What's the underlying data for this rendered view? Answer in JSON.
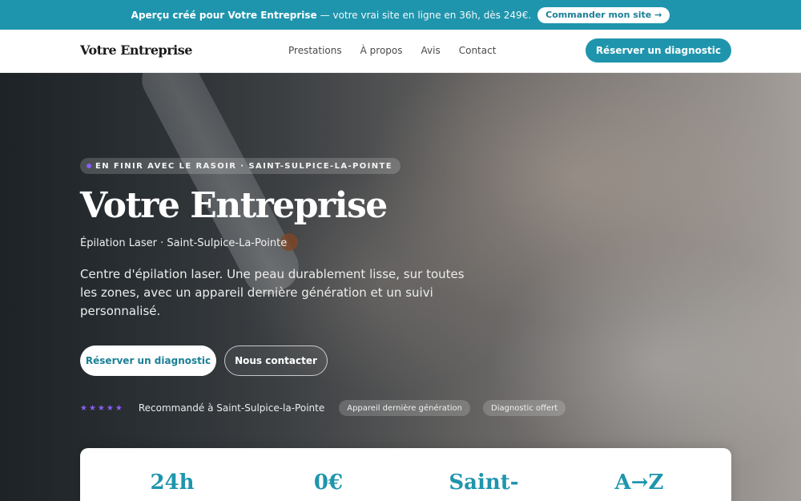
{
  "promo": {
    "strong": "Aperçu créé pour Votre Entreprise",
    "rest": "— votre vrai site en ligne en 36h, dès 249€.",
    "button": "Commander mon site →"
  },
  "nav": {
    "brand": "Votre Entreprise",
    "links": [
      "Prestations",
      "À propos",
      "Avis",
      "Contact"
    ],
    "cta": "Réserver un diagnostic"
  },
  "hero": {
    "badge": "EN FINIR AVEC LE RASOIR · SAINT-SULPICE-LA-POINTE",
    "title": "Votre Entreprise",
    "subtitle": "Épilation Laser · Saint-Sulpice-La-Pointe",
    "description": "Centre d'épilation laser. Une peau durablement lisse, sur toutes les zones, avec un appareil dernière génération et un suivi personnalisé.",
    "primary_button": "Réserver un diagnostic",
    "secondary_button": "Nous contacter",
    "stars": "★★★★★",
    "trust_text": "Recommandé à Saint-Sulpice-la-Pointe",
    "chips": [
      "Appareil dernière génération",
      "Diagnostic offert"
    ]
  },
  "stats": [
    "24h",
    "0€",
    "Saint-",
    "A→Z"
  ],
  "colors": {
    "accent": "#1f95ad",
    "star": "#8b5cf6"
  }
}
